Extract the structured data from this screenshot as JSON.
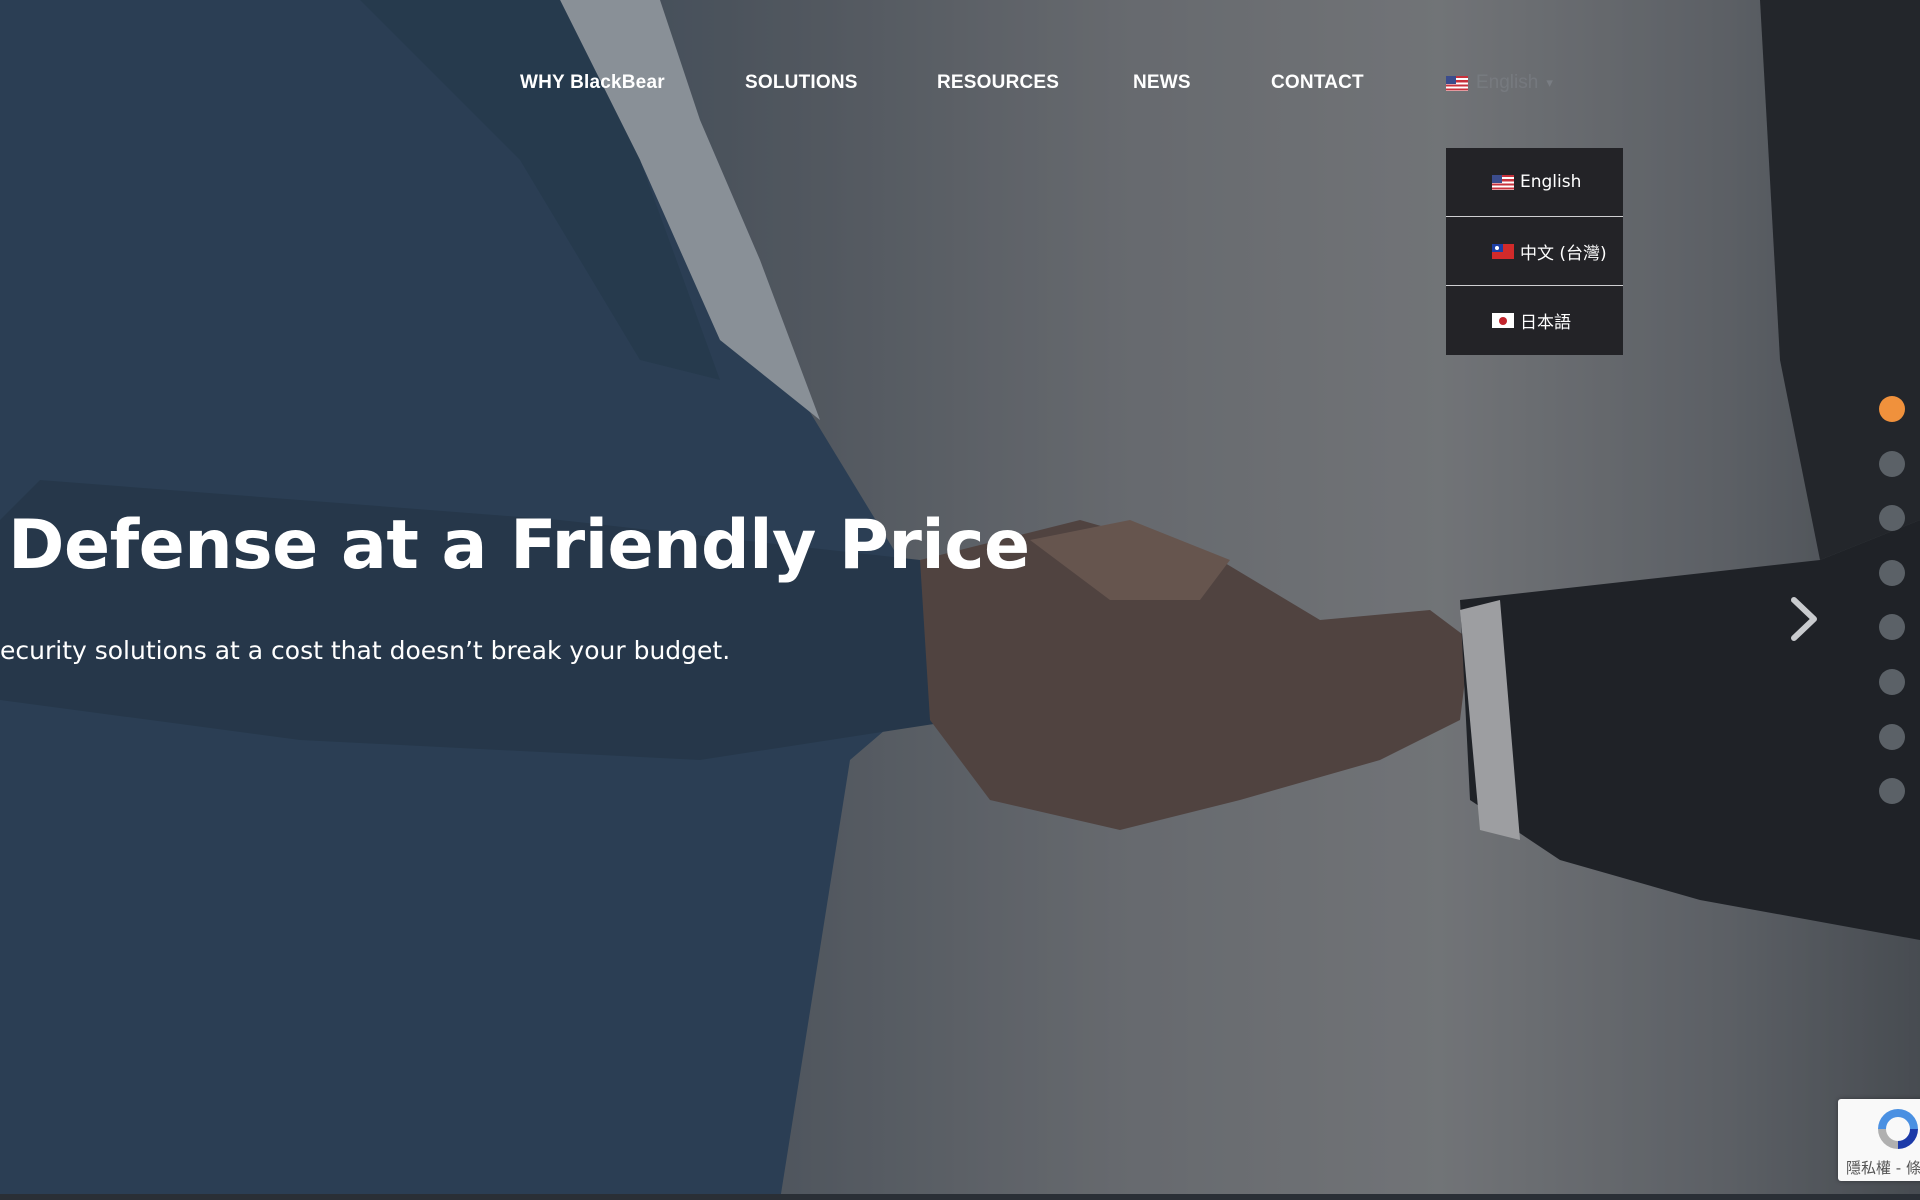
{
  "nav": {
    "items": [
      {
        "label": "WHY BlackBear"
      },
      {
        "label": "SOLUTIONS"
      },
      {
        "label": "RESOURCES"
      },
      {
        "label": "NEWS"
      },
      {
        "label": "CONTACT"
      }
    ],
    "language_toggle": {
      "label": "English",
      "flag": "us-flag-icon"
    }
  },
  "language_menu": {
    "items": [
      {
        "label": "English",
        "flag": "us-flag-icon"
      },
      {
        "label": "中文 (台灣)",
        "flag": "taiwan-flag-icon"
      },
      {
        "label": "日本語",
        "flag": "japan-flag-icon"
      }
    ]
  },
  "hero": {
    "headline": "Defense at a Friendly Price",
    "subline": "ecurity solutions at a cost that doesn’t break your budget."
  },
  "slider": {
    "total_slides": 8,
    "active_index": 0,
    "active_color": "#f0913c",
    "inactive_color": "#5b6167",
    "next_icon": "chevron-right-icon"
  },
  "recaptcha": {
    "text": "隱私權 - 條"
  }
}
